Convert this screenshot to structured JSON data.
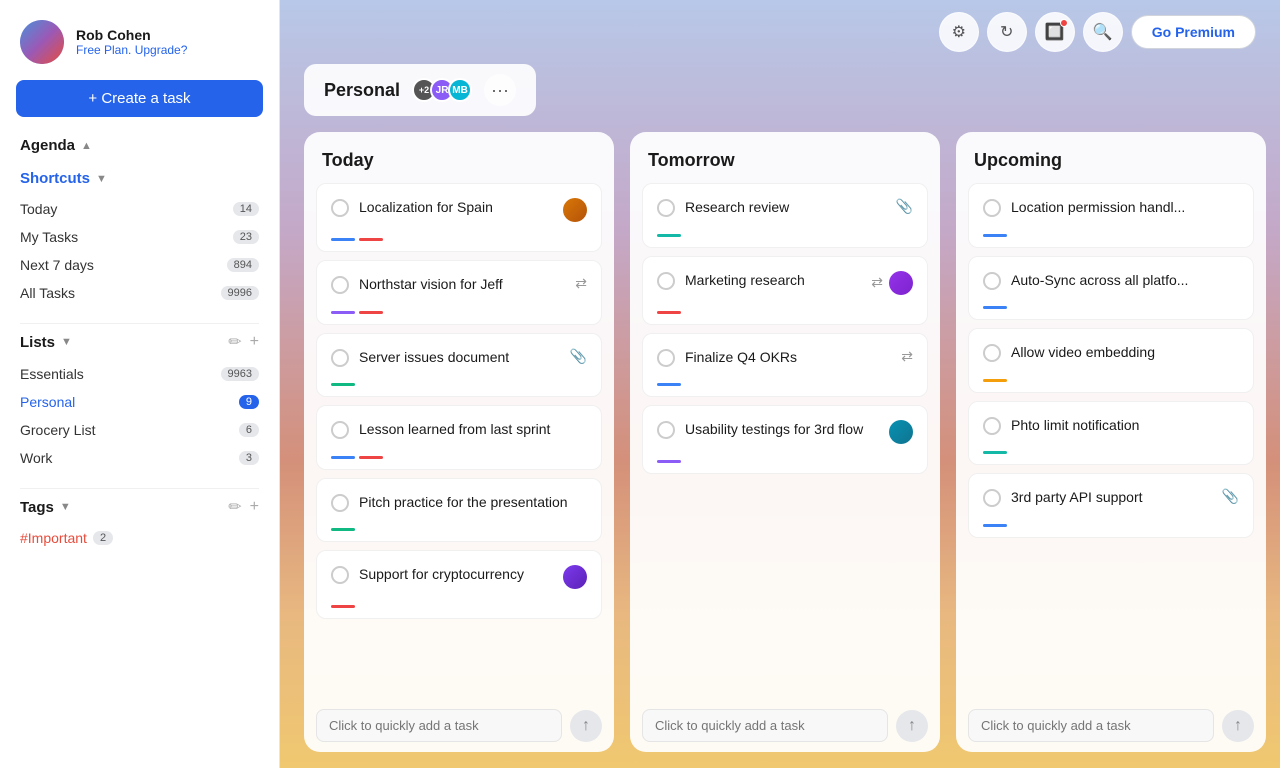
{
  "sidebar": {
    "user": {
      "name": "Rob Cohen",
      "plan": "Free Plan.",
      "upgrade": "Upgrade?"
    },
    "create_task_label": "+ Create a task",
    "agenda_label": "Agenda",
    "shortcuts_label": "Shortcuts",
    "nav_items": [
      {
        "label": "Today",
        "badge": "14"
      },
      {
        "label": "My Tasks",
        "badge": "23"
      },
      {
        "label": "Next 7 days",
        "badge": "894"
      },
      {
        "label": "All Tasks",
        "badge": "9996"
      }
    ],
    "lists_label": "Lists",
    "lists": [
      {
        "label": "Essentials",
        "badge": "9963",
        "active": false
      },
      {
        "label": "Personal",
        "badge": "9",
        "active": true
      },
      {
        "label": "Grocery List",
        "badge": "6",
        "active": false
      },
      {
        "label": "Work",
        "badge": "3",
        "active": false
      }
    ],
    "tags_label": "Tags",
    "tags": [
      {
        "label": "#Important",
        "badge": "2"
      }
    ]
  },
  "topbar": {
    "go_premium": "Go Premium",
    "icons": [
      "gear",
      "refresh",
      "notification",
      "search"
    ]
  },
  "board": {
    "title": "Personal",
    "avatars": [
      "+2",
      "JR",
      "MB"
    ],
    "columns": [
      {
        "title": "Today",
        "tasks": [
          {
            "name": "Localization for Spain",
            "bar": "blue-red",
            "has_avatar": true,
            "avatar_color": "#d97706"
          },
          {
            "name": "Northstar vision for Jeff",
            "bar": "purple-red",
            "has_icon": true,
            "icon": "⇄"
          },
          {
            "name": "Server issues document",
            "bar": "green",
            "has_icon": true,
            "icon": "📎"
          },
          {
            "name": "Lesson learned from last sprint",
            "bar": "blue-red",
            "has_nothing": true
          },
          {
            "name": "Pitch practice for the presentation",
            "bar": "green",
            "has_nothing": true
          },
          {
            "name": "Support for cryptocurrency",
            "bar": "red",
            "has_avatar": true,
            "avatar_color": "#7c3aed"
          }
        ],
        "add_placeholder": "Click to quickly add a task"
      },
      {
        "title": "Tomorrow",
        "tasks": [
          {
            "name": "Research review",
            "bar": "teal",
            "has_icon": true,
            "icon": "📎"
          },
          {
            "name": "Marketing research",
            "bar": "red",
            "has_avatar": true,
            "avatar_color": "#9333ea",
            "has_icon2": true,
            "icon2": "⇄"
          },
          {
            "name": "Finalize Q4 OKRs",
            "bar": "blue",
            "has_icon": true,
            "icon": "⇄"
          },
          {
            "name": "Usability testings for 3rd flow",
            "bar": "purple",
            "has_avatar": true,
            "avatar_color": "#0891b2"
          }
        ],
        "add_placeholder": "Click to quickly add a task"
      },
      {
        "title": "Upcoming",
        "tasks": [
          {
            "name": "Location permission handl...",
            "bar": "blue",
            "has_nothing": true
          },
          {
            "name": "Auto-Sync across all platfo...",
            "bar": "blue",
            "has_nothing": true
          },
          {
            "name": "Allow video embedding",
            "bar": "yellow",
            "has_nothing": true
          },
          {
            "name": "Phto limit notification",
            "bar": "teal",
            "has_nothing": true
          },
          {
            "name": "3rd party API support",
            "bar": "blue",
            "has_icon": true,
            "icon": "📎"
          }
        ],
        "add_placeholder": "Click to quickly add a task"
      }
    ]
  }
}
